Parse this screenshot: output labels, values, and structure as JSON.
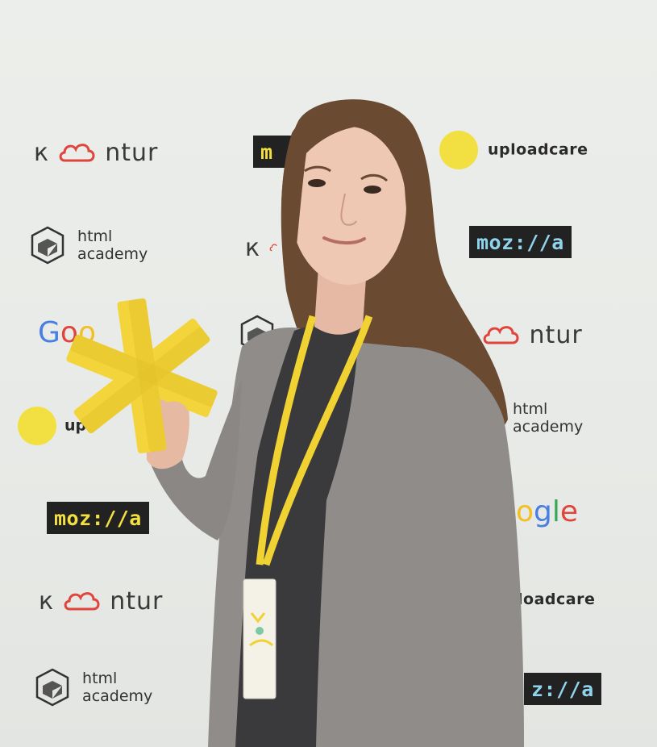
{
  "backdrop": {
    "kontur_text": "ntur",
    "kontur_prefix": "к",
    "uploadcare_text": "uploadcare",
    "uploadcare_partial": "up",
    "uploadcare_right_partial": "loadcare",
    "mozilla_text": "moz://a",
    "mozilla_partial_top": "m",
    "mozilla_partial_bottom": "z://a",
    "html_academy_line1": "html",
    "html_academy_line2": "academy",
    "google_partial_left": "Goo",
    "google_partial_right": "ogle",
    "colors": {
      "uploadcare_dot": "#f2e043",
      "kontur_cloud": "#e0443b",
      "mozilla_bg": "#222222",
      "mozilla_text_yellow": "#f2e043",
      "mozilla_text_blue": "#8fd4ec"
    }
  },
  "subject": {
    "description_icons": [
      "yellow-asterisk-award-icon",
      "lanyard-badge-icon"
    ],
    "colors": {
      "cardigan": "#8f8c89",
      "hair": "#6b4a32",
      "lanyard": "#f0d233",
      "award": "#f3d43a"
    }
  }
}
